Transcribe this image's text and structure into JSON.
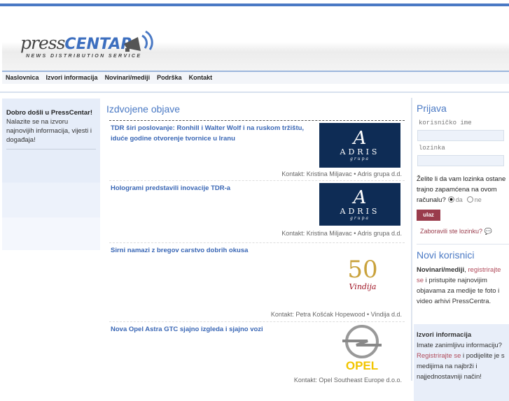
{
  "logo": {
    "press": "press",
    "centar": "CENTAR",
    "tagline": "NEWS DISTRIBUTION SERVICE"
  },
  "nav": [
    "Naslovnica",
    "Izvori informacija",
    "Novinari/mediji",
    "Podrška",
    "Kontakt"
  ],
  "left": {
    "welcome_title": "Dobro došli u PressCentar!",
    "welcome_text": "Nalazite se na izvoru najnovijih informacija, vijesti i događaja!"
  },
  "featured": {
    "heading": "Izdvojene objave",
    "items": [
      {
        "title": "TDR širi poslovanje: Ronhill i Walter Wolf i na ruskom tržištu, iduće godine otvorenje tvornice u Iranu",
        "contact": "Kontakt: Kristina Miljavac • Adris grupa d.d.",
        "logo": {
          "mark": "A",
          "name": "ADRIS",
          "sub": "grupa"
        }
      },
      {
        "title": "Hologrami predstavili inovacije TDR-a",
        "contact": "Kontakt: Kristina Miljavac • Adris grupa d.d.",
        "logo": {
          "mark": "A",
          "name": "ADRIS",
          "sub": "grupa"
        }
      },
      {
        "title": "Sirni namazi z bregov carstvo dobrih okusa",
        "contact": "Kontakt: Petra Košćak Hopewood • Vindija d.d.",
        "logo": {
          "mark": "50",
          "name": "Vindija"
        }
      },
      {
        "title": "Nova Opel Astra GTC sjajno izgleda i sjajno vozi",
        "contact": "Kontakt: Opel Southeast Europe d.o.o.",
        "logo": {
          "name": "OPEL"
        }
      }
    ]
  },
  "login": {
    "heading": "Prijava",
    "username_label": "korisničko ime",
    "password_label": "lozinka",
    "username": "",
    "password": "",
    "remember_question": "Želite li da vam lozinka ostane trajno zapamćena na ovom računalu?",
    "yes": "da",
    "no": "ne",
    "submit": "ulaz",
    "forgot": "Zaboravili ste lozinku?"
  },
  "new_users": {
    "heading": "Novi korisnici",
    "media_bold": "Novinari/mediji",
    "media_sep": ", ",
    "media_link": "registrirajte se",
    "media_text": " i pristupite najnovijim objavama za medije te foto i video arhivi PressCentra.",
    "sources_title": "Izvori informacija",
    "sources_text1": "Imate zanimljivu informaciju? ",
    "sources_link": "Registrirajte se",
    "sources_text2": " i podijelite je s medijima na najbrži i najjednostavniji način!"
  },
  "colors": {
    "accent": "#4a79c4",
    "button": "#9a3c4c",
    "adris": "#0e2c55"
  }
}
